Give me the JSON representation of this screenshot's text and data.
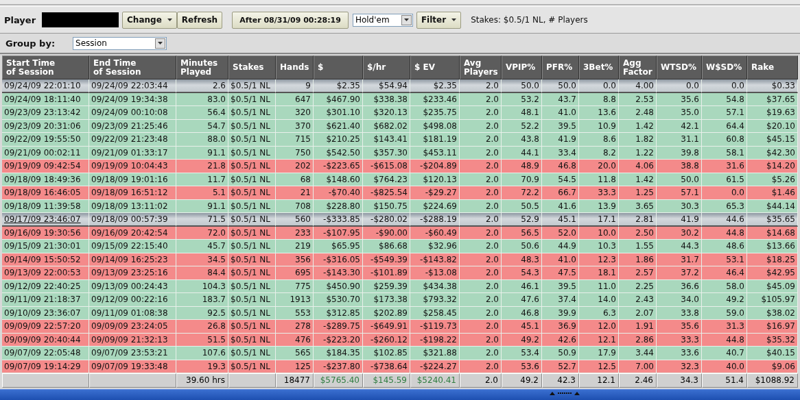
{
  "toolbar": {
    "player_label": "Player",
    "buttons": [
      {
        "label": "Change",
        "kind": "menu"
      },
      {
        "label": "Refresh",
        "kind": "plain"
      }
    ],
    "date_button": "After 08/31/09 00:28:19",
    "game_select": "Hold'em",
    "filter_button": {
      "label": "Filter",
      "kind": "menu"
    },
    "summary": "Stakes: $0.5/1 NL, # Players"
  },
  "group_by": {
    "label": "Group by:",
    "value": "Session"
  },
  "table": {
    "columns": [
      "Start Time\nof Session",
      "End Time\nof Session",
      "Minutes\nPlayed",
      "Stakes",
      "Hands",
      "$",
      "$/hr",
      "$ EV",
      "Avg\nPlayers",
      "VPIP%",
      "PFR%",
      "3Bet%",
      "Agg\nFactor",
      "WTSD%",
      "W$SD%",
      "Rake"
    ],
    "rows": [
      {
        "kind": "win",
        "selected": true,
        "focused": false,
        "cells": [
          "09/24/09 22:01:10",
          "09/24/09 22:03:44",
          "2.6",
          "$0.5/1 NL",
          "9",
          "$2.35",
          "$54.94",
          "$2.35",
          "2.0",
          "50.0",
          "50.0",
          "0.0",
          "4.00",
          "0.0",
          "0.0",
          "$0.33"
        ]
      },
      {
        "kind": "win",
        "selected": false,
        "focused": false,
        "cells": [
          "09/24/09 18:11:40",
          "09/24/09 19:34:38",
          "83.0",
          "$0.5/1 NL",
          "647",
          "$467.90",
          "$338.38",
          "$233.46",
          "2.0",
          "53.2",
          "43.7",
          "8.8",
          "2.53",
          "35.6",
          "54.8",
          "$37.65"
        ]
      },
      {
        "kind": "win",
        "selected": false,
        "focused": false,
        "cells": [
          "09/23/09 23:13:42",
          "09/24/09 00:10:08",
          "56.4",
          "$0.5/1 NL",
          "320",
          "$301.10",
          "$320.13",
          "$235.75",
          "2.0",
          "48.1",
          "41.0",
          "13.6",
          "2.48",
          "35.0",
          "57.1",
          "$19.63"
        ]
      },
      {
        "kind": "win",
        "selected": false,
        "focused": false,
        "cells": [
          "09/23/09 20:31:06",
          "09/23/09 21:25:46",
          "54.7",
          "$0.5/1 NL",
          "370",
          "$621.40",
          "$682.02",
          "$498.08",
          "2.0",
          "52.2",
          "39.5",
          "10.9",
          "1.42",
          "42.1",
          "64.4",
          "$20.10"
        ]
      },
      {
        "kind": "win",
        "selected": false,
        "focused": false,
        "cells": [
          "09/22/09 19:55:50",
          "09/22/09 21:23:48",
          "88.0",
          "$0.5/1 NL",
          "715",
          "$210.25",
          "$143.41",
          "$181.19",
          "2.0",
          "43.8",
          "41.9",
          "8.6",
          "1.82",
          "31.1",
          "60.8",
          "$45.15"
        ]
      },
      {
        "kind": "win",
        "selected": false,
        "focused": false,
        "cells": [
          "09/21/09 00:02:11",
          "09/21/09 01:33:17",
          "91.1",
          "$0.5/1 NL",
          "750",
          "$542.50",
          "$357.30",
          "$453.11",
          "2.0",
          "44.1",
          "33.4",
          "8.2",
          "1.22",
          "39.8",
          "58.1",
          "$42.30"
        ]
      },
      {
        "kind": "loss",
        "selected": false,
        "focused": false,
        "cells": [
          "09/19/09 09:42:54",
          "09/19/09 10:04:43",
          "21.8",
          "$0.5/1 NL",
          "202",
          "-$223.65",
          "-$615.08",
          "-$204.89",
          "2.0",
          "48.9",
          "46.8",
          "20.0",
          "4.06",
          "38.8",
          "31.6",
          "$14.20"
        ]
      },
      {
        "kind": "win",
        "selected": false,
        "focused": false,
        "cells": [
          "09/18/09 18:49:36",
          "09/18/09 19:01:16",
          "11.7",
          "$0.5/1 NL",
          "68",
          "$148.60",
          "$764.23",
          "$120.13",
          "2.0",
          "70.9",
          "54.5",
          "11.8",
          "1.42",
          "50.0",
          "61.5",
          "$5.26"
        ]
      },
      {
        "kind": "loss",
        "selected": false,
        "focused": false,
        "cells": [
          "09/18/09 16:46:05",
          "09/18/09 16:51:12",
          "5.1",
          "$0.5/1 NL",
          "21",
          "-$70.40",
          "-$825.54",
          "-$29.27",
          "2.0",
          "72.2",
          "66.7",
          "33.3",
          "1.25",
          "57.1",
          "0.0",
          "$1.46"
        ]
      },
      {
        "kind": "win",
        "selected": false,
        "focused": false,
        "cells": [
          "09/18/09 11:39:58",
          "09/18/09 13:11:02",
          "91.1",
          "$0.5/1 NL",
          "708",
          "$228.80",
          "$150.75",
          "$224.69",
          "2.0",
          "50.5",
          "41.6",
          "13.9",
          "3.65",
          "30.3",
          "65.3",
          "$44.14"
        ]
      },
      {
        "kind": "loss",
        "selected": true,
        "focused": true,
        "cells": [
          "09/17/09 23:46:07",
          "09/18/09 00:57:39",
          "71.5",
          "$0.5/1 NL",
          "560",
          "-$333.85",
          "-$280.02",
          "-$288.19",
          "2.0",
          "52.9",
          "45.1",
          "17.1",
          "2.81",
          "41.9",
          "44.6",
          "$35.65"
        ]
      },
      {
        "kind": "loss",
        "selected": false,
        "focused": false,
        "cells": [
          "09/16/09 19:30:56",
          "09/16/09 20:42:54",
          "72.0",
          "$0.5/1 NL",
          "233",
          "-$107.95",
          "-$90.00",
          "-$60.49",
          "2.0",
          "56.5",
          "52.0",
          "10.0",
          "2.50",
          "30.2",
          "44.8",
          "$14.68"
        ]
      },
      {
        "kind": "win",
        "selected": false,
        "focused": false,
        "cells": [
          "09/15/09 21:30:01",
          "09/15/09 22:15:40",
          "45.7",
          "$0.5/1 NL",
          "219",
          "$65.95",
          "$86.68",
          "$32.96",
          "2.0",
          "50.6",
          "44.9",
          "10.3",
          "1.55",
          "44.3",
          "48.6",
          "$13.66"
        ]
      },
      {
        "kind": "loss",
        "selected": false,
        "focused": false,
        "cells": [
          "09/14/09 15:50:52",
          "09/14/09 16:25:23",
          "34.5",
          "$0.5/1 NL",
          "356",
          "-$316.05",
          "-$549.39",
          "-$143.82",
          "2.0",
          "48.3",
          "41.0",
          "12.3",
          "1.86",
          "31.7",
          "53.1",
          "$18.25"
        ]
      },
      {
        "kind": "loss",
        "selected": false,
        "focused": false,
        "cells": [
          "09/13/09 22:00:53",
          "09/13/09 23:25:16",
          "84.4",
          "$0.5/1 NL",
          "695",
          "-$143.30",
          "-$101.89",
          "-$13.08",
          "2.0",
          "54.3",
          "47.5",
          "18.1",
          "2.57",
          "37.2",
          "46.4",
          "$42.95"
        ]
      },
      {
        "kind": "win",
        "selected": false,
        "focused": false,
        "cells": [
          "09/12/09 22:40:25",
          "09/13/09 00:24:43",
          "104.3",
          "$0.5/1 NL",
          "775",
          "$450.90",
          "$259.39",
          "$434.38",
          "2.0",
          "46.1",
          "39.5",
          "11.0",
          "2.25",
          "36.6",
          "58.0",
          "$45.09"
        ]
      },
      {
        "kind": "win",
        "selected": false,
        "focused": false,
        "cells": [
          "09/11/09 21:18:37",
          "09/12/09 00:22:16",
          "183.7",
          "$0.5/1 NL",
          "1913",
          "$530.70",
          "$173.38",
          "$793.32",
          "2.0",
          "47.6",
          "37.4",
          "14.0",
          "2.43",
          "34.0",
          "49.2",
          "$105.97"
        ]
      },
      {
        "kind": "win",
        "selected": false,
        "focused": false,
        "cells": [
          "09/10/09 23:36:07",
          "09/11/09 01:08:38",
          "92.5",
          "$0.5/1 NL",
          "553",
          "$312.85",
          "$202.89",
          "$258.45",
          "2.0",
          "46.8",
          "39.9",
          "6.3",
          "2.07",
          "33.8",
          "59.0",
          "$38.02"
        ]
      },
      {
        "kind": "loss",
        "selected": false,
        "focused": false,
        "cells": [
          "09/09/09 22:57:20",
          "09/09/09 23:24:05",
          "26.8",
          "$0.5/1 NL",
          "278",
          "-$289.75",
          "-$649.91",
          "-$119.73",
          "2.0",
          "45.1",
          "36.9",
          "12.0",
          "1.91",
          "35.6",
          "31.3",
          "$16.97"
        ]
      },
      {
        "kind": "loss",
        "selected": false,
        "focused": false,
        "cells": [
          "09/09/09 20:40:44",
          "09/09/09 21:32:13",
          "51.5",
          "$0.5/1 NL",
          "476",
          "-$223.20",
          "-$260.12",
          "-$198.22",
          "2.0",
          "49.2",
          "42.6",
          "12.1",
          "2.86",
          "33.3",
          "44.8",
          "$35.32"
        ]
      },
      {
        "kind": "win",
        "selected": false,
        "focused": false,
        "cells": [
          "09/07/09 22:05:48",
          "09/07/09 23:53:21",
          "107.6",
          "$0.5/1 NL",
          "565",
          "$184.35",
          "$102.85",
          "$321.88",
          "2.0",
          "53.4",
          "50.9",
          "17.9",
          "3.44",
          "33.6",
          "40.7",
          "$40.15"
        ]
      },
      {
        "kind": "loss",
        "selected": false,
        "focused": false,
        "cells": [
          "09/07/09 19:14:29",
          "09/07/09 19:33:48",
          "19.3",
          "$0.5/1 NL",
          "125",
          "-$237.80",
          "-$738.64",
          "-$224.27",
          "2.0",
          "53.6",
          "52.7",
          "12.5",
          "7.00",
          "32.3",
          "40.0",
          "$9.06"
        ]
      }
    ],
    "totals": [
      {
        "kind": "blank"
      },
      {
        "kind": "blank"
      },
      {
        "kind": "plain",
        "text": "39.60 hrs"
      },
      {
        "kind": "blank"
      },
      {
        "kind": "plain",
        "text": "18477"
      },
      {
        "kind": "positive",
        "text": "$5765.40"
      },
      {
        "kind": "positive",
        "text": "$145.59"
      },
      {
        "kind": "positive",
        "text": "$5240.41"
      },
      {
        "kind": "plain",
        "text": "2.0"
      },
      {
        "kind": "plain",
        "text": "49.2"
      },
      {
        "kind": "plain",
        "text": "42.3"
      },
      {
        "kind": "plain",
        "text": "12.1"
      },
      {
        "kind": "plain",
        "text": "2.46"
      },
      {
        "kind": "plain",
        "text": "34.3"
      },
      {
        "kind": "plain",
        "text": "51.4"
      },
      {
        "kind": "plain",
        "text": "$1088.92"
      }
    ]
  }
}
